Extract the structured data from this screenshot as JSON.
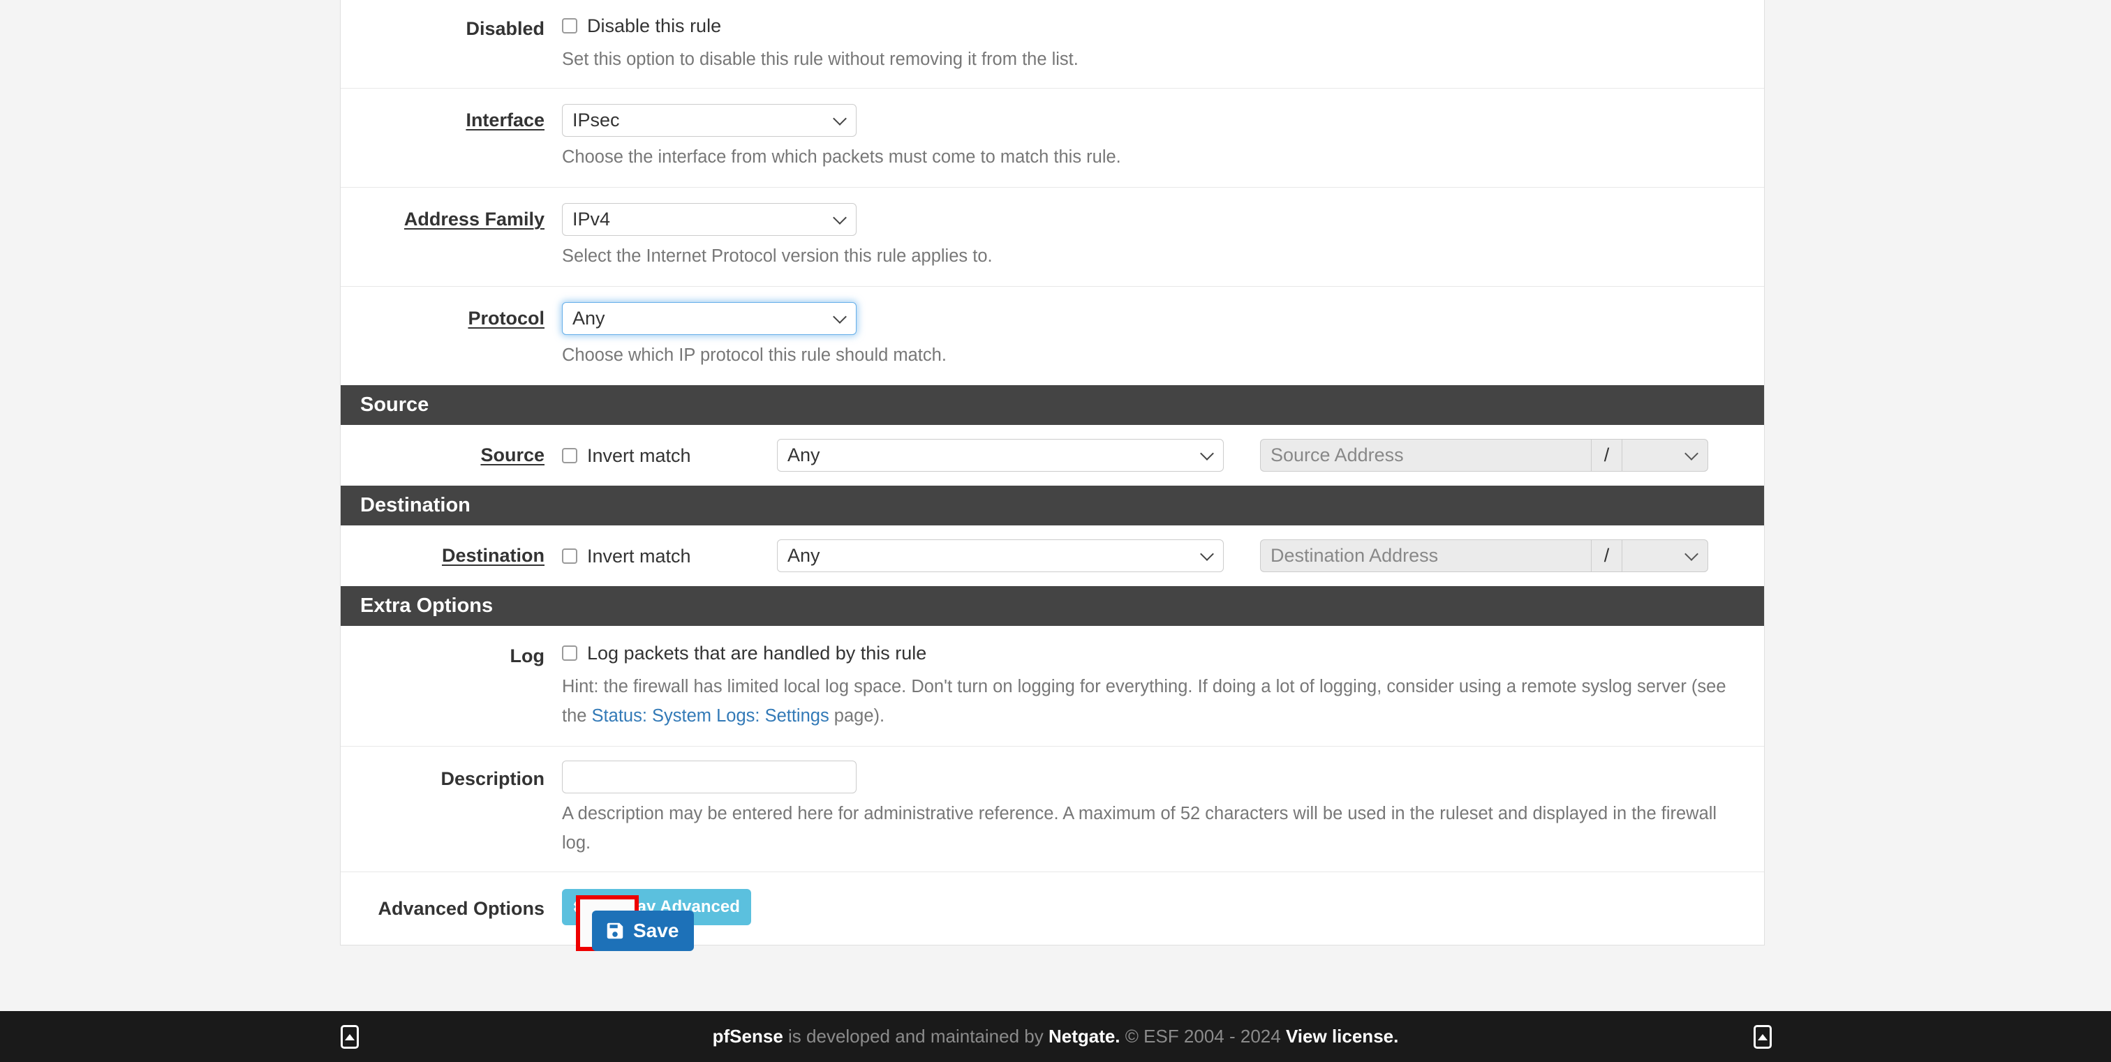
{
  "form": {
    "rows": [
      {
        "label": "Disabled",
        "label_link": false,
        "checkbox_label": "Disable this rule",
        "help": "Set this option to disable this rule without removing it from the list."
      },
      {
        "label": "Interface",
        "label_link": true,
        "value": "IPsec",
        "help": "Choose the interface from which packets must come to match this rule."
      },
      {
        "label": "Address Family",
        "label_link": true,
        "value": "IPv4",
        "help": "Select the Internet Protocol version this rule applies to."
      },
      {
        "label": "Protocol",
        "label_link": true,
        "value": "Any",
        "help": "Choose which IP protocol this rule should match.",
        "focused": true
      }
    ]
  },
  "source_section": {
    "header": "Source",
    "label": "Source",
    "invert_label": "Invert match",
    "type_value": "Any",
    "address_placeholder": "Source Address",
    "slash": "/",
    "mask_value": ""
  },
  "destination_section": {
    "header": "Destination",
    "label": "Destination",
    "invert_label": "Invert match",
    "type_value": "Any",
    "address_placeholder": "Destination Address",
    "slash": "/",
    "mask_value": ""
  },
  "extra_options": {
    "header": "Extra Options",
    "log": {
      "label": "Log",
      "checkbox_label": "Log packets that are handled by this rule",
      "help_before": "Hint: the firewall has limited local log space. Don't turn on logging for everything. If doing a lot of logging, consider using a remote syslog server (see the ",
      "help_link": "Status: System Logs: Settings",
      "help_after": " page)."
    },
    "description": {
      "label": "Description",
      "value": "",
      "help": "A description may be entered here for administrative reference. A maximum of 52 characters will be used in the ruleset and displayed in the firewall log."
    },
    "advanced": {
      "label": "Advanced Options",
      "button_label": "Display Advanced"
    }
  },
  "actions": {
    "save_label": "Save"
  },
  "footer": {
    "brand": "pfSense",
    "text_mid": " is developed and maintained by ",
    "company": "Netgate.",
    "copyright": " © ESF 2004 - 2024 ",
    "license_link": "View license."
  },
  "colors": {
    "section_header_bg": "#444444",
    "primary_button": "#1d71b8",
    "info_button": "#5bc0de",
    "highlight_border": "#ee0000",
    "link": "#337ab7",
    "focus_ring": "#66afe9"
  }
}
